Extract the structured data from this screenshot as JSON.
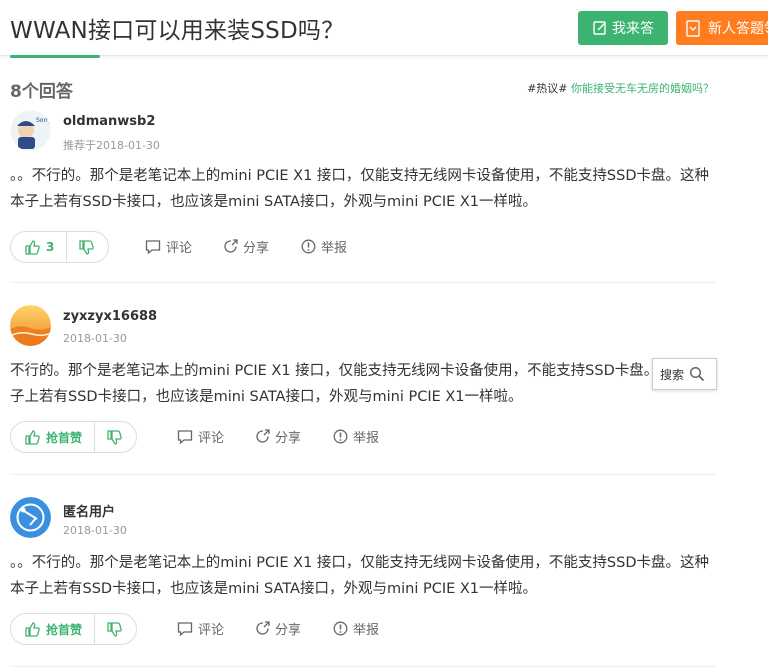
{
  "question": {
    "title": "WWAN接口可以用来装SSD吗？",
    "answer_button": "我来答",
    "newbie_button": "新人答题领"
  },
  "answers_header": {
    "count": "8个回答",
    "hot_tag": "#热议#",
    "hot_link": " 你能接受无车无房的婚姻吗？"
  },
  "answers": [
    {
      "username": "oldmanwsb2",
      "date": "推荐于2018-01-30",
      "text": "。。不行的。那个是老笔记本上的mini PCIE X1 接口，仅能支持无线网卡设备使用，不能支持SSD卡盘。这种本子上若有SSD卡接口，也应该是mini SATA接口，外观与mini PCIE X1一样啦。",
      "vote_label": "3",
      "comment": "评论",
      "share": "分享",
      "report": "举报"
    },
    {
      "username": "zyxzyx16688",
      "date": "2018-01-30",
      "text": "不行的。那个是老笔记本上的mini PCIE X1 接口，仅能支持无线网卡设备使用，不能支持SSD卡盘。这种本子上若有SSD卡接口，也应该是mini SATA接口，外观与mini PCIE X1一样啦。",
      "vote_label": "抢首赞",
      "comment": "评论",
      "share": "分享",
      "report": "举报"
    },
    {
      "username": "匿名用户",
      "date": "2018-01-30",
      "text": "。。不行的。那个是老笔记本上的mini PCIE X1 接口，仅能支持无线网卡设备使用，不能支持SSD卡盘。这种本子上若有SSD卡接口，也应该是mini SATA接口，外观与mini PCIE X1一样啦。",
      "vote_label": "抢首赞",
      "comment": "评论",
      "share": "分享",
      "report": "举报"
    }
  ],
  "search_popup": {
    "label": "搜索"
  },
  "colors": {
    "accent": "#3cb371",
    "orange": "#ff7d1f"
  },
  "icons": [
    "edit-icon",
    "gift-icon",
    "thumb-up-icon",
    "thumb-down-icon",
    "comment-icon",
    "share-icon",
    "report-icon",
    "search-icon"
  ]
}
